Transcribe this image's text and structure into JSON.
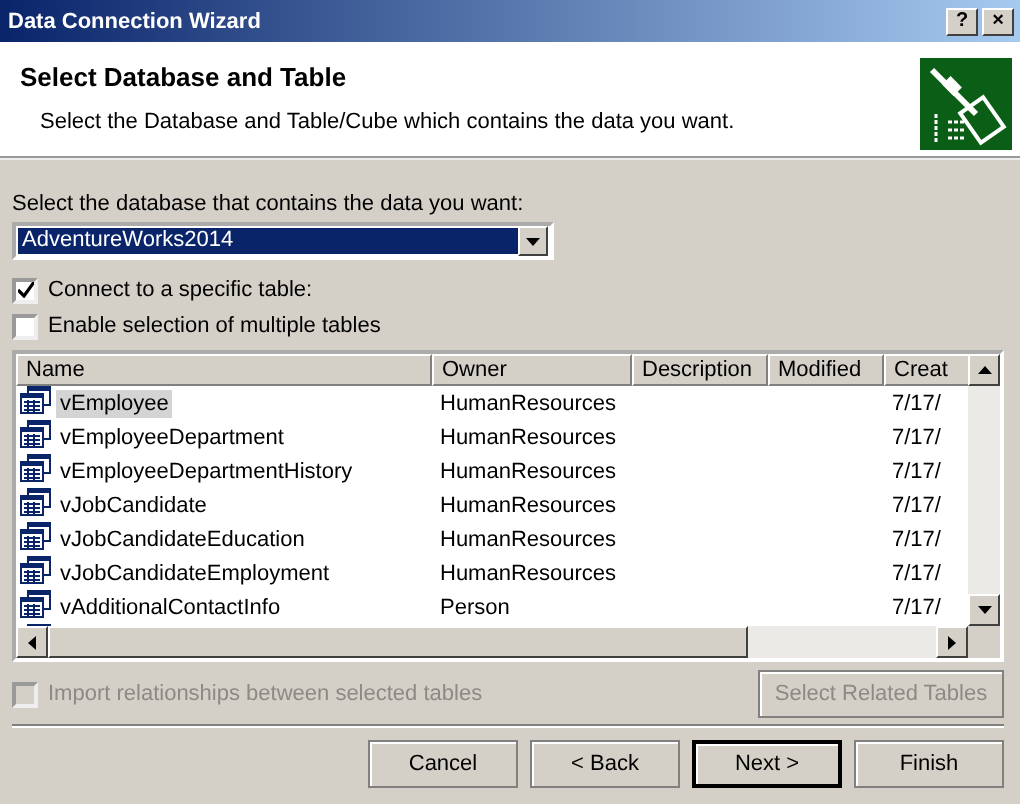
{
  "window": {
    "title": "Data Connection Wizard",
    "buttons": [
      "?",
      "×"
    ]
  },
  "header": {
    "title": "Select Database and Table",
    "subtitle": "Select the Database and Table/Cube which contains the data you want."
  },
  "database": {
    "label": "Select the database that contains the data you want:",
    "value": "AdventureWorks2014"
  },
  "options": [
    {
      "label": "Connect to a specific table:",
      "checked": true,
      "disabled": false
    },
    {
      "label": "Enable selection of multiple tables",
      "checked": false,
      "disabled": false
    }
  ],
  "table": {
    "columns": [
      "Name",
      "Owner",
      "Description",
      "Modified",
      "Creat"
    ],
    "rows": [
      {
        "name": "vEmployee",
        "owner": "HumanResources",
        "created": "7/17/",
        "selected": true
      },
      {
        "name": "vEmployeeDepartment",
        "owner": "HumanResources",
        "created": "7/17/",
        "selected": false
      },
      {
        "name": "vEmployeeDepartmentHistory",
        "owner": "HumanResources",
        "created": "7/17/",
        "selected": false
      },
      {
        "name": "vJobCandidate",
        "owner": "HumanResources",
        "created": "7/17/",
        "selected": false
      },
      {
        "name": "vJobCandidateEducation",
        "owner": "HumanResources",
        "created": "7/17/",
        "selected": false
      },
      {
        "name": "vJobCandidateEmployment",
        "owner": "HumanResources",
        "created": "7/17/",
        "selected": false
      },
      {
        "name": "vAdditionalContactInfo",
        "owner": "Person",
        "created": "7/17/",
        "selected": false
      }
    ]
  },
  "import_option": {
    "label": "Import relationships between selected tables",
    "checked": false,
    "disabled": true
  },
  "related_button": {
    "label": "Select Related Tables",
    "disabled": true
  },
  "buttons": [
    {
      "label": "Cancel",
      "default": false
    },
    {
      "label": "< Back",
      "default": false
    },
    {
      "label": "Next >",
      "default": true
    },
    {
      "label": "Finish",
      "default": false
    }
  ]
}
